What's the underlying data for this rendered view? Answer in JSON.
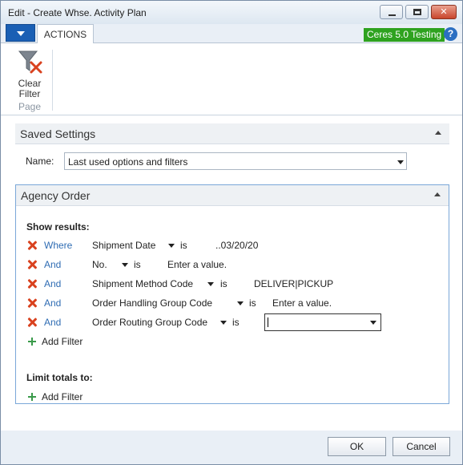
{
  "window": {
    "title": "Edit - Create Whse. Activity Plan"
  },
  "ribbon": {
    "tab_label": "ACTIONS",
    "company_badge": "Ceres 5.0 Testing",
    "help_glyph": "?",
    "clear_filter_label_line1": "Clear",
    "clear_filter_label_line2": "Filter",
    "group_label": "Page"
  },
  "saved_settings": {
    "header": "Saved Settings",
    "name_label": "Name:",
    "name_value": "Last used options and filters"
  },
  "agency_order": {
    "header": "Agency Order",
    "show_results_label": "Show results:",
    "filters": [
      {
        "conjunction": "Where",
        "field": "Shipment Date",
        "operator": "is",
        "value": "..03/20/20"
      },
      {
        "conjunction": "And",
        "field": "No.",
        "operator": "is",
        "value": "Enter a value."
      },
      {
        "conjunction": "And",
        "field": "Shipment Method Code",
        "operator": "is",
        "value": "DELIVER|PICKUP"
      },
      {
        "conjunction": "And",
        "field": "Order Handling Group Code",
        "operator": "is",
        "value": "Enter a value."
      },
      {
        "conjunction": "And",
        "field": "Order Routing Group Code",
        "operator": "is",
        "value": ""
      }
    ],
    "add_filter_label": "Add Filter",
    "limit_totals_label": "Limit totals to:",
    "limit_add_filter_label": "Add Filter"
  },
  "footer": {
    "ok_label": "OK",
    "cancel_label": "Cancel"
  },
  "colors": {
    "accent": "#1a5fb4",
    "badge": "#2ea21f",
    "remove": "#d9421f",
    "add": "#3a9a4a",
    "link": "#2f6cb3"
  }
}
